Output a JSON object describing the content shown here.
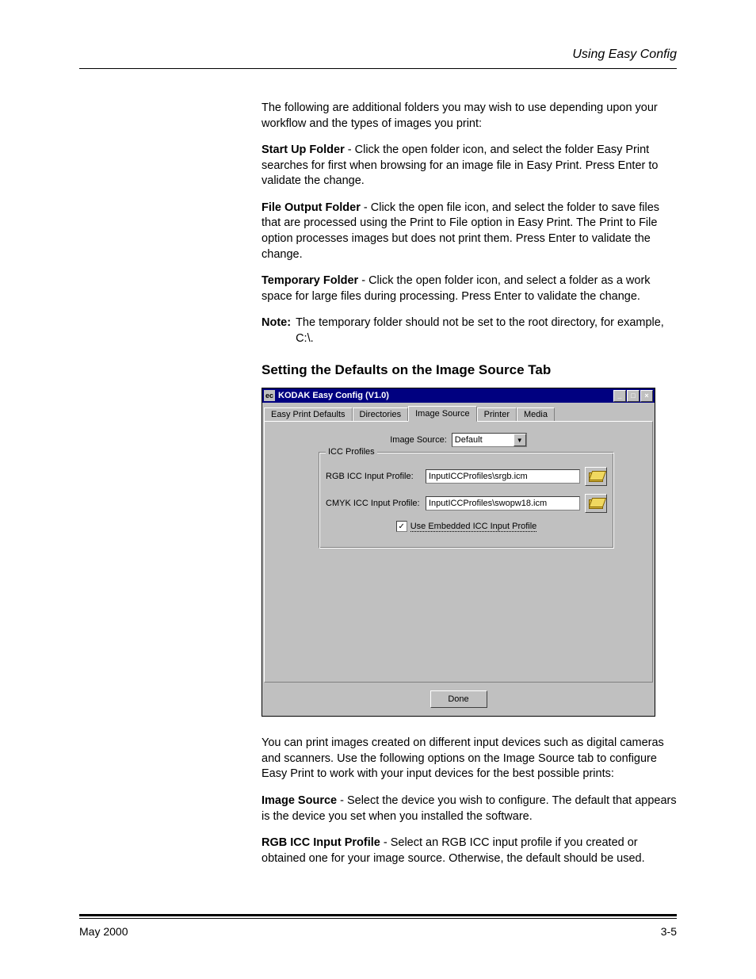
{
  "header": {
    "title": "Using Easy Config"
  },
  "intro": "The following are additional folders you may wish to use depending upon your workflow and the types of images you print:",
  "paragraphs": {
    "startup": {
      "label": "Start Up Folder",
      "text": " - Click the open folder icon, and select the folder Easy Print searches for first when browsing for an image file in Easy Print. Press Enter to validate the change."
    },
    "fileout": {
      "label": "File Output Folder",
      "text": " - Click the open file icon, and select the folder to save files that are processed using the Print to File option in Easy Print. The Print to File option processes images but does not print them. Press Enter to validate the change."
    },
    "temp": {
      "label": "Temporary Folder",
      "text": " - Click the open folder icon, and select a folder as a work space for large files during processing. Press Enter to validate the change."
    }
  },
  "note": {
    "label": "Note:",
    "text": "The temporary folder should not be set to the root directory, for example, C:\\."
  },
  "heading": "Setting the Defaults on the Image Source Tab",
  "window": {
    "title": "KODAK Easy Config (V1.0)",
    "tabs": [
      "Easy Print Defaults",
      "Directories",
      "Image Source",
      "Printer",
      "Media"
    ],
    "image_source_label": "Image Source:",
    "image_source_value": "Default",
    "groupbox_title": "ICC Profiles",
    "rgb_label": "RGB ICC Input Profile:",
    "rgb_value": "InputICCProfiles\\srgb.icm",
    "cmyk_label": "CMYK ICC Input Profile:",
    "cmyk_value": "InputICCProfiles\\swopw18.icm",
    "checkbox_label": "Use Embedded ICC Input Profile",
    "done": "Done"
  },
  "lower": {
    "intro": "You can print images created on different input devices such as digital cameras and scanners. Use the following options on the Image Source tab to configure Easy Print to work with your input devices for the best possible prints:",
    "imgsrc": {
      "label": "Image Source",
      "text": " - Select the device you wish to configure. The default that appears is the device you set when you installed the software."
    },
    "rgb": {
      "label": "RGB ICC Input Profile",
      "text": " - Select an RGB ICC input profile if you created or obtained one for your image source. Otherwise, the default should be used."
    }
  },
  "footer": {
    "left": "May 2000",
    "right": "3-5"
  }
}
